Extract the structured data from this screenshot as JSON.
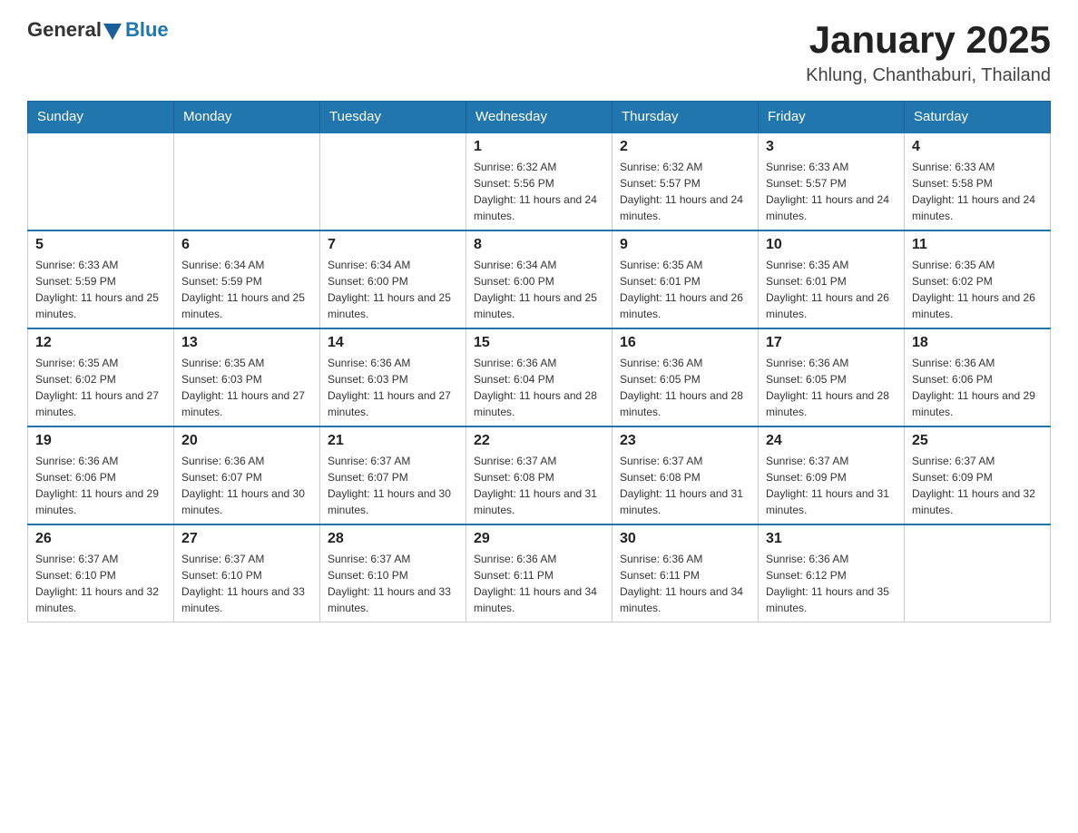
{
  "header": {
    "logo_general": "General",
    "logo_blue": "Blue",
    "month_title": "January 2025",
    "location": "Khlung, Chanthaburi, Thailand"
  },
  "days_of_week": [
    "Sunday",
    "Monday",
    "Tuesday",
    "Wednesday",
    "Thursday",
    "Friday",
    "Saturday"
  ],
  "weeks": [
    [
      {
        "day": "",
        "info": ""
      },
      {
        "day": "",
        "info": ""
      },
      {
        "day": "",
        "info": ""
      },
      {
        "day": "1",
        "info": "Sunrise: 6:32 AM\nSunset: 5:56 PM\nDaylight: 11 hours and 24 minutes."
      },
      {
        "day": "2",
        "info": "Sunrise: 6:32 AM\nSunset: 5:57 PM\nDaylight: 11 hours and 24 minutes."
      },
      {
        "day": "3",
        "info": "Sunrise: 6:33 AM\nSunset: 5:57 PM\nDaylight: 11 hours and 24 minutes."
      },
      {
        "day": "4",
        "info": "Sunrise: 6:33 AM\nSunset: 5:58 PM\nDaylight: 11 hours and 24 minutes."
      }
    ],
    [
      {
        "day": "5",
        "info": "Sunrise: 6:33 AM\nSunset: 5:59 PM\nDaylight: 11 hours and 25 minutes."
      },
      {
        "day": "6",
        "info": "Sunrise: 6:34 AM\nSunset: 5:59 PM\nDaylight: 11 hours and 25 minutes."
      },
      {
        "day": "7",
        "info": "Sunrise: 6:34 AM\nSunset: 6:00 PM\nDaylight: 11 hours and 25 minutes."
      },
      {
        "day": "8",
        "info": "Sunrise: 6:34 AM\nSunset: 6:00 PM\nDaylight: 11 hours and 25 minutes."
      },
      {
        "day": "9",
        "info": "Sunrise: 6:35 AM\nSunset: 6:01 PM\nDaylight: 11 hours and 26 minutes."
      },
      {
        "day": "10",
        "info": "Sunrise: 6:35 AM\nSunset: 6:01 PM\nDaylight: 11 hours and 26 minutes."
      },
      {
        "day": "11",
        "info": "Sunrise: 6:35 AM\nSunset: 6:02 PM\nDaylight: 11 hours and 26 minutes."
      }
    ],
    [
      {
        "day": "12",
        "info": "Sunrise: 6:35 AM\nSunset: 6:02 PM\nDaylight: 11 hours and 27 minutes."
      },
      {
        "day": "13",
        "info": "Sunrise: 6:35 AM\nSunset: 6:03 PM\nDaylight: 11 hours and 27 minutes."
      },
      {
        "day": "14",
        "info": "Sunrise: 6:36 AM\nSunset: 6:03 PM\nDaylight: 11 hours and 27 minutes."
      },
      {
        "day": "15",
        "info": "Sunrise: 6:36 AM\nSunset: 6:04 PM\nDaylight: 11 hours and 28 minutes."
      },
      {
        "day": "16",
        "info": "Sunrise: 6:36 AM\nSunset: 6:05 PM\nDaylight: 11 hours and 28 minutes."
      },
      {
        "day": "17",
        "info": "Sunrise: 6:36 AM\nSunset: 6:05 PM\nDaylight: 11 hours and 28 minutes."
      },
      {
        "day": "18",
        "info": "Sunrise: 6:36 AM\nSunset: 6:06 PM\nDaylight: 11 hours and 29 minutes."
      }
    ],
    [
      {
        "day": "19",
        "info": "Sunrise: 6:36 AM\nSunset: 6:06 PM\nDaylight: 11 hours and 29 minutes."
      },
      {
        "day": "20",
        "info": "Sunrise: 6:36 AM\nSunset: 6:07 PM\nDaylight: 11 hours and 30 minutes."
      },
      {
        "day": "21",
        "info": "Sunrise: 6:37 AM\nSunset: 6:07 PM\nDaylight: 11 hours and 30 minutes."
      },
      {
        "day": "22",
        "info": "Sunrise: 6:37 AM\nSunset: 6:08 PM\nDaylight: 11 hours and 31 minutes."
      },
      {
        "day": "23",
        "info": "Sunrise: 6:37 AM\nSunset: 6:08 PM\nDaylight: 11 hours and 31 minutes."
      },
      {
        "day": "24",
        "info": "Sunrise: 6:37 AM\nSunset: 6:09 PM\nDaylight: 11 hours and 31 minutes."
      },
      {
        "day": "25",
        "info": "Sunrise: 6:37 AM\nSunset: 6:09 PM\nDaylight: 11 hours and 32 minutes."
      }
    ],
    [
      {
        "day": "26",
        "info": "Sunrise: 6:37 AM\nSunset: 6:10 PM\nDaylight: 11 hours and 32 minutes."
      },
      {
        "day": "27",
        "info": "Sunrise: 6:37 AM\nSunset: 6:10 PM\nDaylight: 11 hours and 33 minutes."
      },
      {
        "day": "28",
        "info": "Sunrise: 6:37 AM\nSunset: 6:10 PM\nDaylight: 11 hours and 33 minutes."
      },
      {
        "day": "29",
        "info": "Sunrise: 6:36 AM\nSunset: 6:11 PM\nDaylight: 11 hours and 34 minutes."
      },
      {
        "day": "30",
        "info": "Sunrise: 6:36 AM\nSunset: 6:11 PM\nDaylight: 11 hours and 34 minutes."
      },
      {
        "day": "31",
        "info": "Sunrise: 6:36 AM\nSunset: 6:12 PM\nDaylight: 11 hours and 35 minutes."
      },
      {
        "day": "",
        "info": ""
      }
    ]
  ]
}
